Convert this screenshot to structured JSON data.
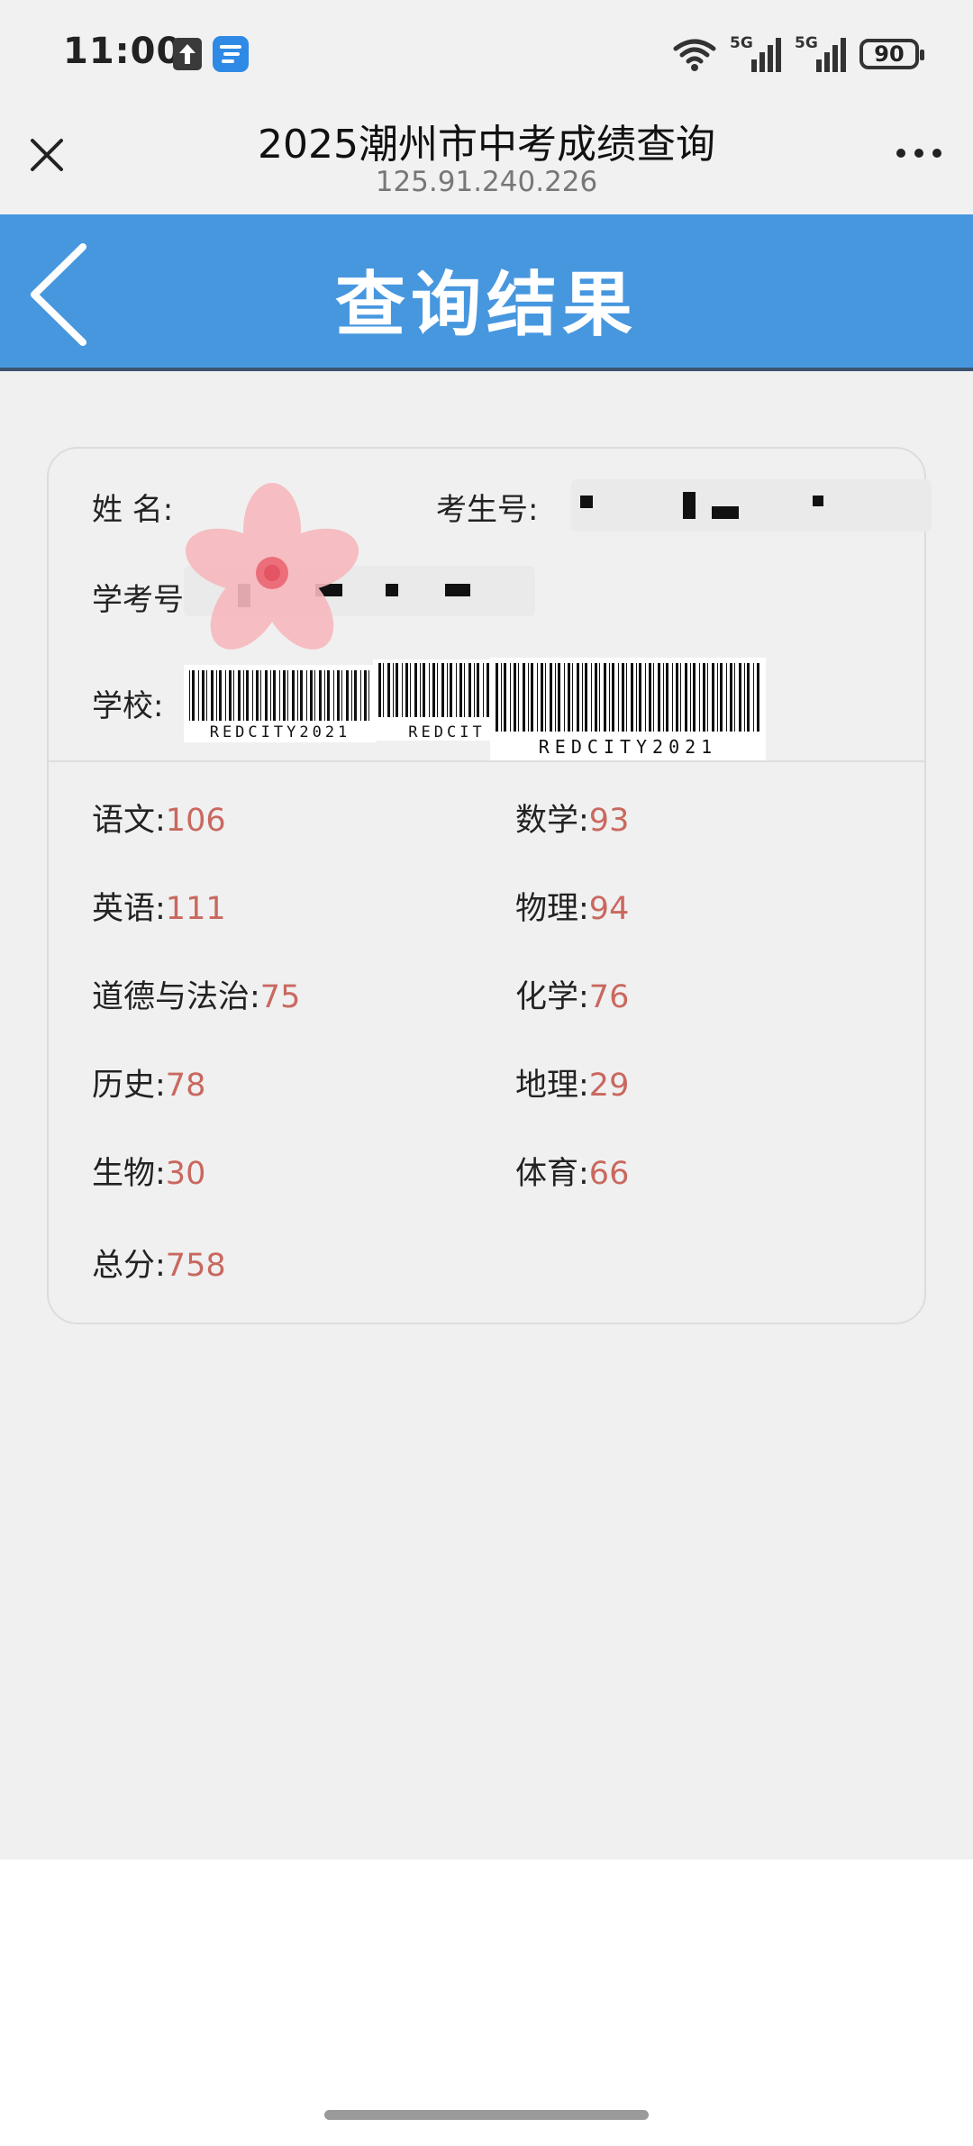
{
  "status_bar": {
    "time": "11:00",
    "network_label_1": "5G",
    "network_label_2": "5G",
    "battery": "90",
    "icons": [
      "upload-icon",
      "app-badge-icon",
      "wifi-icon",
      "signal-icon",
      "signal-icon",
      "battery-icon"
    ]
  },
  "browser": {
    "title": "2025潮州市中考成绩查询",
    "url": "125.91.240.226",
    "icons": [
      "close-icon",
      "more-icon"
    ]
  },
  "page": {
    "header_title": "查询结果",
    "icons": [
      "back-icon"
    ]
  },
  "student_info": {
    "name_label": "姓 名:",
    "exam_number_label": "考生号:",
    "student_number_label": "学考号:",
    "school_label": "学校:",
    "barcode_text_1": "REDCITY2021",
    "barcode_text_2": "REDCIT",
    "barcode_text_3": "REDCITY2021"
  },
  "scores": [
    {
      "subject": "语文:",
      "score": "106"
    },
    {
      "subject": "数学:",
      "score": "93"
    },
    {
      "subject": "英语:",
      "score": "111"
    },
    {
      "subject": "物理:",
      "score": "94"
    },
    {
      "subject": "道德与法治:",
      "score": "75"
    },
    {
      "subject": "化学:",
      "score": "76"
    },
    {
      "subject": "历史:",
      "score": "78"
    },
    {
      "subject": "地理:",
      "score": "29"
    },
    {
      "subject": "生物:",
      "score": "30"
    },
    {
      "subject": "体育:",
      "score": "66"
    }
  ],
  "total": {
    "label": "总分:",
    "score": "758"
  },
  "colors": {
    "accent_blue": "#4797df",
    "score_red": "#c9685f",
    "background_gray": "#f0f0f0"
  }
}
